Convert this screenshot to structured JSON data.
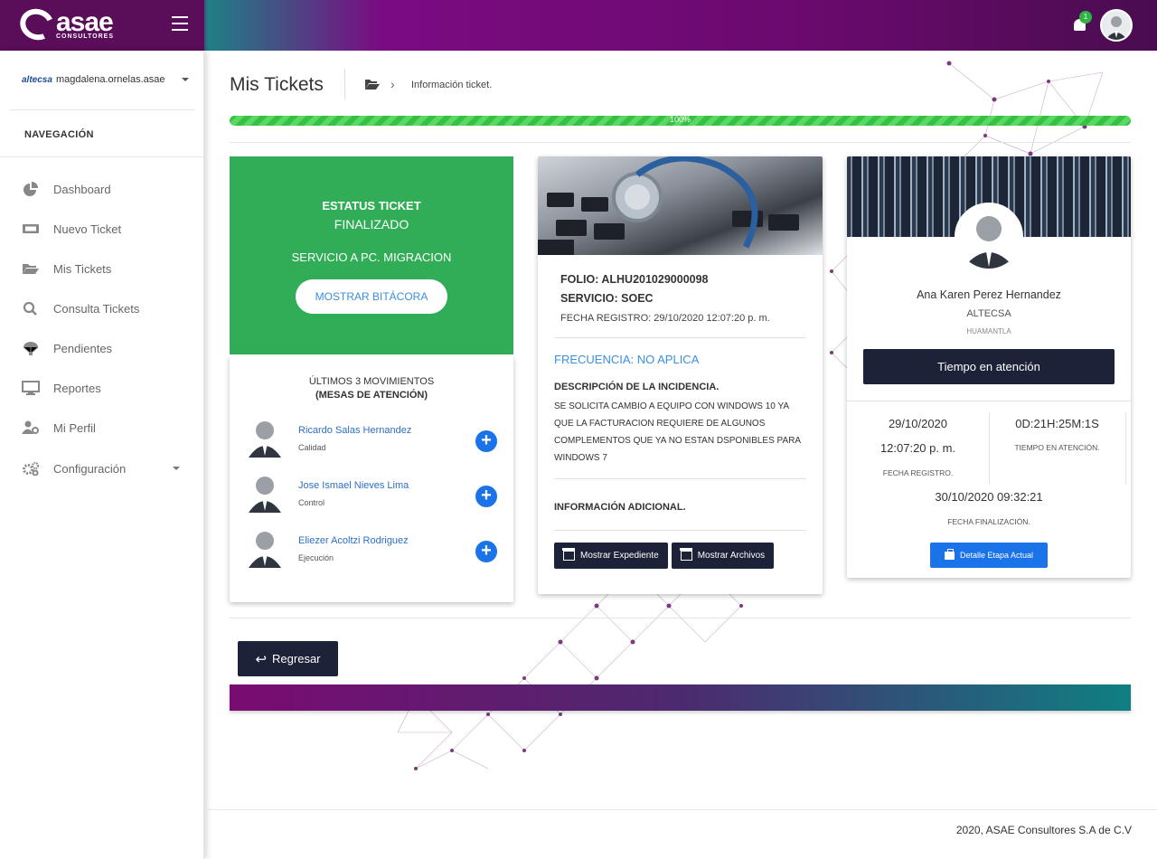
{
  "brand": {
    "name": "asae",
    "sub": "CONSULTORES"
  },
  "header": {
    "notifications": "1"
  },
  "sidebar": {
    "company": "altecsa",
    "username": "magdalena.ornelas.asae",
    "nav_heading": "NAVEGACIÓN",
    "items": [
      {
        "label": "Dashboard",
        "icon": "pie-chart-icon"
      },
      {
        "label": "Nuevo Ticket",
        "icon": "ticket-icon"
      },
      {
        "label": "Mis Tickets",
        "icon": "folder-open-icon"
      },
      {
        "label": "Consulta Tickets",
        "icon": "search-icon"
      },
      {
        "label": "Pendientes",
        "icon": "parachute-icon"
      },
      {
        "label": "Reportes",
        "icon": "monitor-icon"
      },
      {
        "label": "Mi Perfil",
        "icon": "user-cog-icon"
      },
      {
        "label": "Configuración",
        "icon": "gears-icon"
      }
    ]
  },
  "page": {
    "title": "Mis Tickets",
    "breadcrumb": "Información ticket.",
    "progress_label": "100%",
    "progress_value": 100
  },
  "status_card": {
    "title": "ESTATUS TICKET",
    "status": "FINALIZADO",
    "service": "SERVICIO A PC. MIGRACION",
    "button": "MOSTRAR BITÁCORA"
  },
  "movements": {
    "title": "ÚLTIMOS 3 MOVIMIENTOS",
    "subtitle": "(MESAS DE ATENCIÓN)",
    "items": [
      {
        "name": "Ricardo Salas Hernandez",
        "role": "Calidad"
      },
      {
        "name": "Jose Ismael Nieves Lima",
        "role": "Control"
      },
      {
        "name": "Eliezer Acoltzi Rodriguez",
        "role": "Ejecución"
      }
    ]
  },
  "ticket": {
    "folio": "FOLIO: ALHU201029000098",
    "servicio": "SERVICIO: SOEC",
    "fecha_registro": "FECHA REGISTRO: 29/10/2020 12:07:20 p. m.",
    "frecuencia": "FRECUENCIA: NO APLICA",
    "descripcion_titulo": "DESCRIPCIÓN DE LA INCIDENCIA.",
    "descripcion": "SE SOLICITA CAMBIO A EQUIPO CON WINDOWS 10 YA QUE LA FACTURACION REQUIERE DE ALGUNOS COMPLEMENTOS QUE YA NO ESTAN DSPONIBLES PARA WINDOWS 7",
    "info_adicional": "INFORMACIÓN ADICIONAL.",
    "btn_expediente": "Mostrar Expediente",
    "btn_archivos": "Mostrar Archivos"
  },
  "agent": {
    "name": "Ana Karen Perez Hernandez",
    "company": "ALTECSA",
    "location": "HUAMANTLA",
    "attention_button": "Tiempo en atención",
    "reg_date": "29/10/2020",
    "reg_time": "12:07:20 p. m.",
    "reg_label": "FECHA REGISTRO.",
    "duration": "0D:21H:25M:1S",
    "duration_label": "TIEMPO EN ATENCIÓN.",
    "end_datetime": "30/10/2020 09:32:21",
    "end_label": "FECHA FINALIZACIÓN.",
    "detail_button": "Detalle Etapa Actual"
  },
  "actions": {
    "back": "Regresar"
  },
  "footer": {
    "copyright": "2020, ASAE Consultores S.A de C.V"
  },
  "colors": {
    "status_green": "#30ad56",
    "dark_button": "#1c2238",
    "link_blue": "#2c6fc4",
    "accent_blue": "#1a73e8",
    "purple": "#7b0b82",
    "teal": "#0f7f82"
  }
}
